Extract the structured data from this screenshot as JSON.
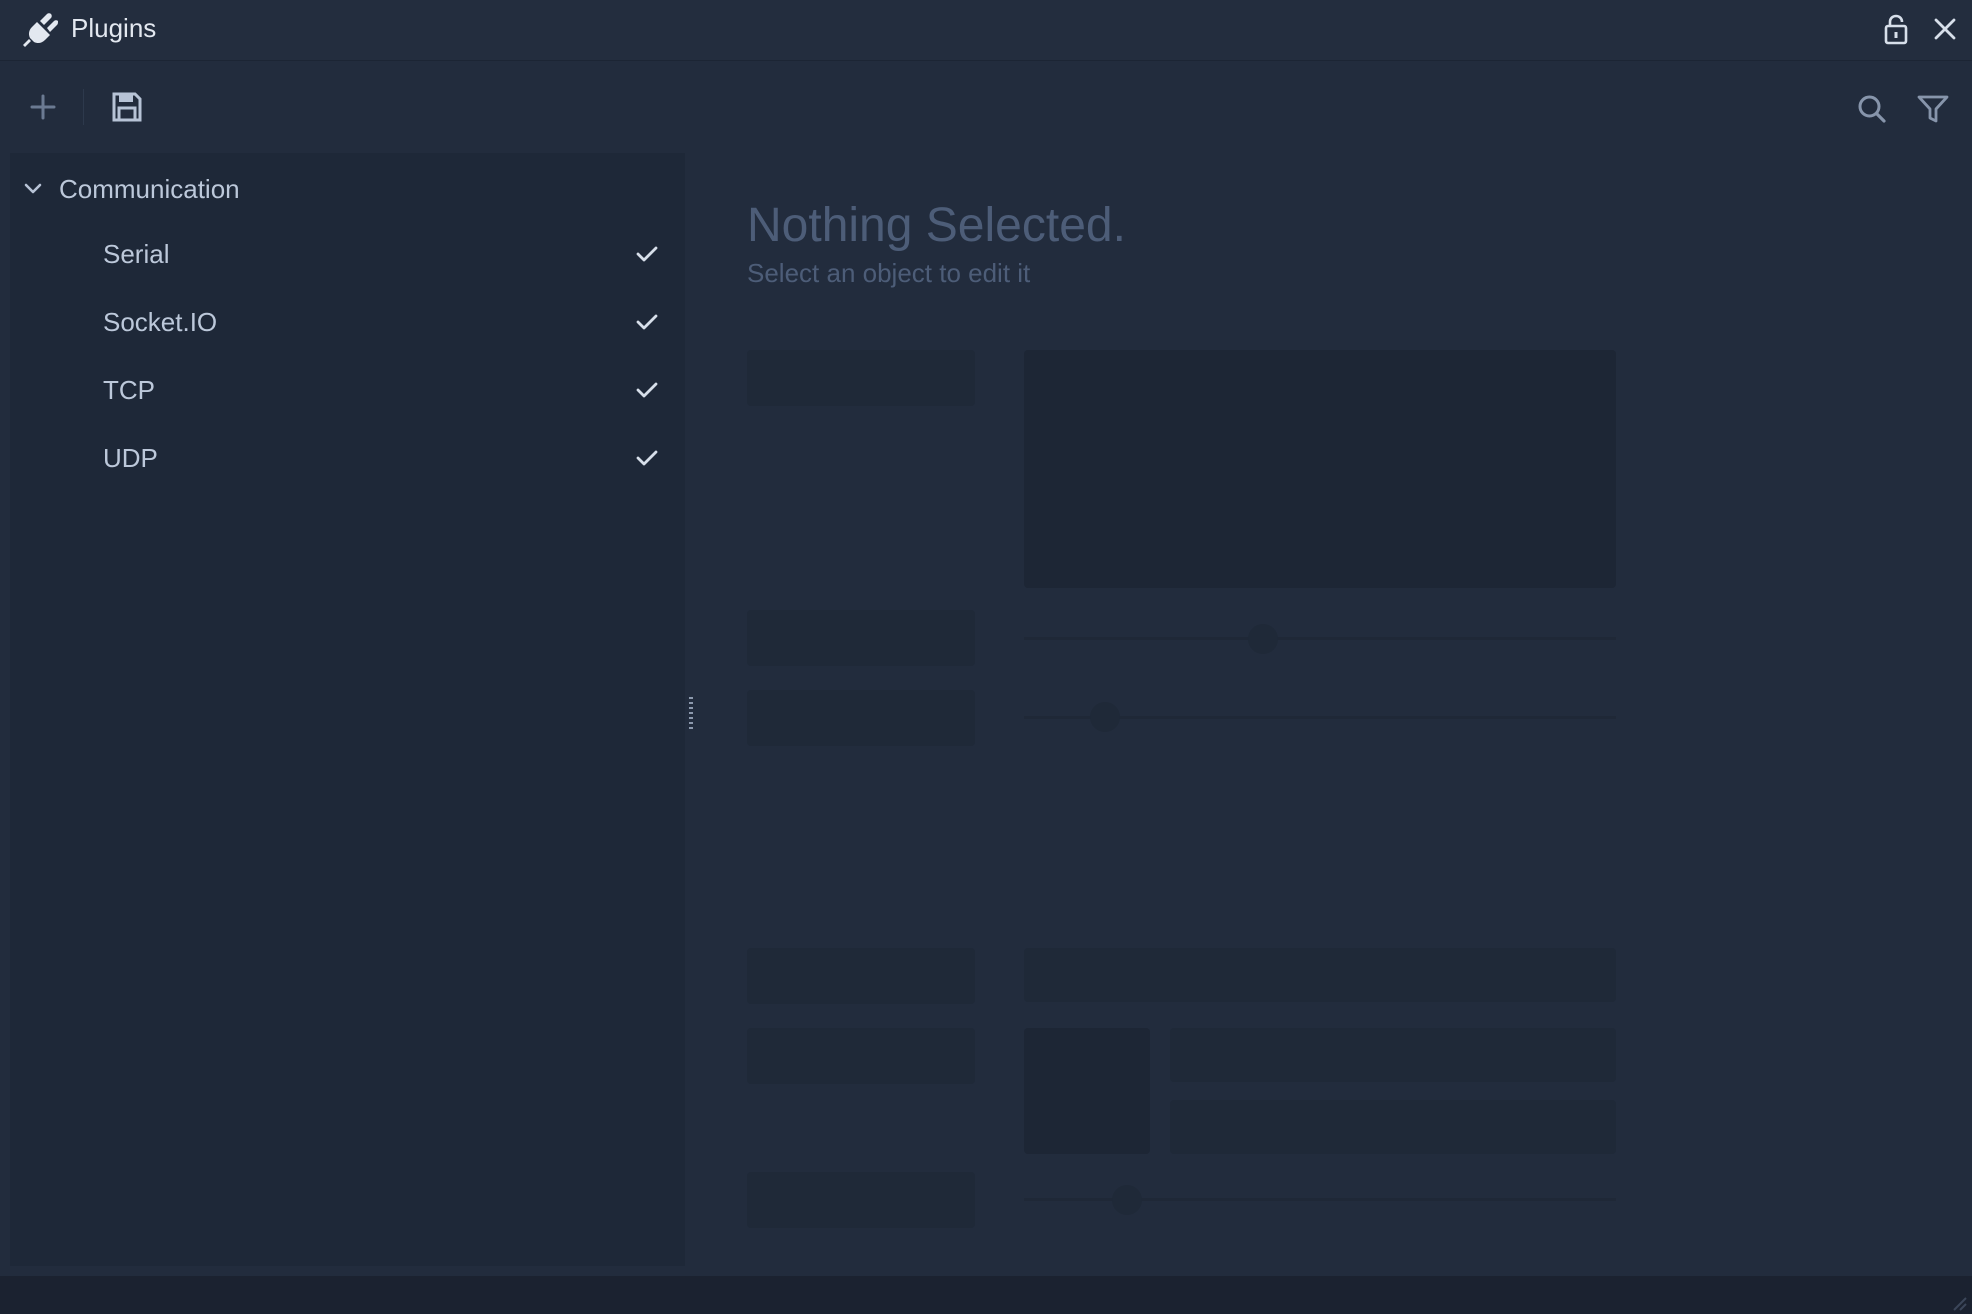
{
  "window": {
    "title": "Plugins",
    "title_icon": "plug-icon",
    "actions": [
      {
        "name": "lock-icon"
      },
      {
        "name": "close-icon"
      }
    ]
  },
  "toolbar": {
    "left": [
      {
        "name": "add-icon"
      },
      {
        "name": "save-icon"
      }
    ],
    "right": [
      {
        "name": "search-icon"
      },
      {
        "name": "filter-icon"
      }
    ]
  },
  "sidebar": {
    "group": {
      "label": "Communication",
      "expanded": true,
      "items": [
        {
          "label": "Serial",
          "enabled": true
        },
        {
          "label": "Socket.IO",
          "enabled": true
        },
        {
          "label": "TCP",
          "enabled": true
        },
        {
          "label": "UDP",
          "enabled": true
        }
      ]
    }
  },
  "inspector": {
    "empty_title": "Nothing Selected.",
    "empty_subtitle": "Select an object to edit it"
  },
  "colors": {
    "background": "#222c3d",
    "sidebar": "#1e2838",
    "text": "#bcc8da",
    "muted_text": "#4d5d78"
  }
}
